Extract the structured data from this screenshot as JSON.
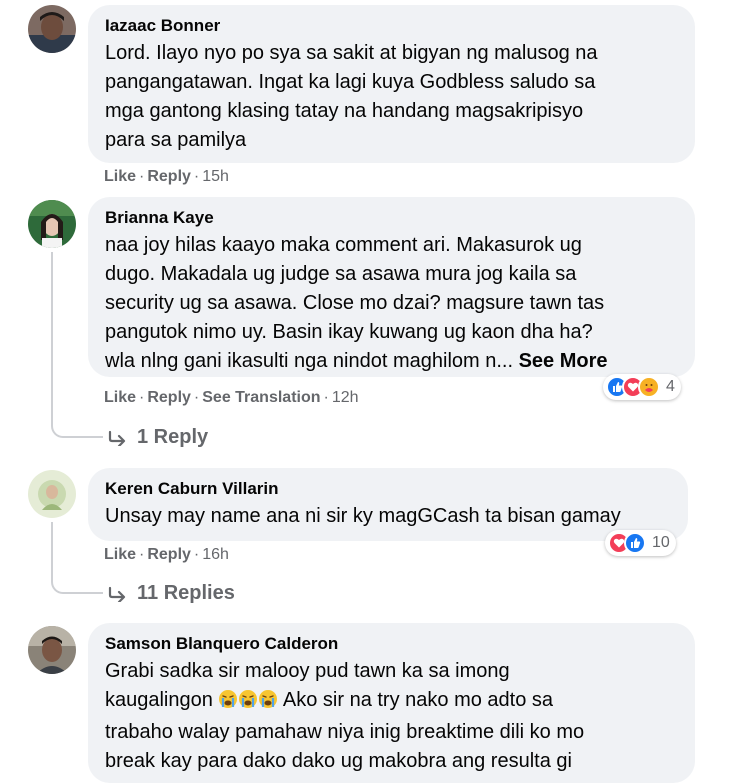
{
  "comments": [
    {
      "author": "Iazaac Bonner",
      "lines": [
        "Lord. Ilayo nyo po sya sa sakit at bigyan ng malusog na",
        "pangangatawan. Ingat ka lagi kuya Godbless saludo sa",
        "mga gantong klasing tatay na handang magsakripisyo",
        "para sa pamilya"
      ],
      "actions": {
        "like": "Like",
        "reply": "Reply",
        "time": "15h"
      }
    },
    {
      "author": "Brianna Kaye",
      "lines": [
        "naa joy hilas kaayo maka comment ari. Makasurok ug",
        "dugo. Makadala ug judge sa asawa mura jog kaila sa",
        "security ug sa asawa. Close mo dzai? magsure tawn tas",
        "pangutok nimo uy. Basin ikay kuwang ug kaon dha ha?",
        "wla nlng gani ikasulti nga nindot maghilom n..."
      ],
      "see_more": "See More",
      "actions": {
        "like": "Like",
        "reply": "Reply",
        "translate": "See Translation",
        "time": "12h"
      },
      "reactions": {
        "count": "4",
        "icons": [
          "like-icon",
          "love-icon",
          "care-icon"
        ]
      },
      "replies_link": "1 Reply"
    },
    {
      "author": "Keren Caburn Villarin",
      "lines": [
        "Unsay may name ana ni sir ky magGCash ta bisan gamay"
      ],
      "actions": {
        "like": "Like",
        "reply": "Reply",
        "time": "16h"
      },
      "reactions": {
        "count": "10",
        "icons": [
          "love-icon",
          "like-icon"
        ]
      },
      "replies_link": "11 Replies"
    },
    {
      "author": "Samson Blanquero Calderon",
      "lines": [
        "Grabi sadka sir malooy pud tawn ka sa imong",
        "kaugalingon",
        "trabaho walay pamahaw niya inig breaktime dili ko mo",
        "break kay para dako dako ug makobra ang resulta gi"
      ],
      "line2_suffix": " Ako sir na try nako mo adto sa",
      "line2_emojis": [
        "crying-face-icon",
        "crying-face-icon",
        "crying-face-icon"
      ]
    }
  ],
  "colors": {
    "bubble": "#f0f2f5",
    "meta_text": "#65676b",
    "like_blue": "#1877f2",
    "love_red": "#f33e58",
    "care_yellow": "#f7b125"
  }
}
